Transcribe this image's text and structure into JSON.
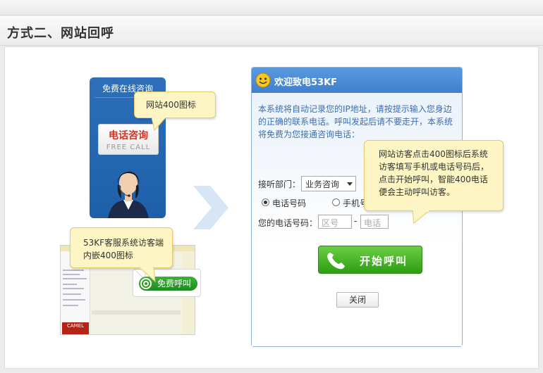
{
  "header": {
    "title": "方式二、网站回呼"
  },
  "widget": {
    "title": "免费在线咨询",
    "phone_cn": "电话咨询",
    "phone_en": "FREE CALL"
  },
  "callouts": {
    "web400": "网站400图标",
    "client400": "53KF客服系统访客端内嵌400图标",
    "instructions": "网站访客点击400图标后系统访客填写手机或电话号码后，点击开始呼叫，智能400电话便会主动呼叫访客。"
  },
  "chat_shot": {
    "free_call_button": "免费呼叫",
    "logo_text": "CAMEL"
  },
  "dialog": {
    "title": "欢迎致电53KF",
    "intro": "本系统将自动记录您的IP地址，请按提示输入您身边的正确的联系电话。呼叫发起后请不要走开，本系统将免费为您接通咨询电话：",
    "dept_label": "接听部门：",
    "dept_value": "业务咨询",
    "radio_phone": "电话号码",
    "radio_mobile": "手机号码",
    "phone_label": "您的电话号码：",
    "area_placeholder": "区号",
    "number_placeholder": "电话号码",
    "dash": "-",
    "call_button": "开始呼叫",
    "close_button": "关闭"
  },
  "colors": {
    "accent_blue": "#3f7fcd",
    "call_green": "#2e9d14",
    "callout_bg": "#fdf6c4",
    "phone_red": "#d8301c"
  }
}
